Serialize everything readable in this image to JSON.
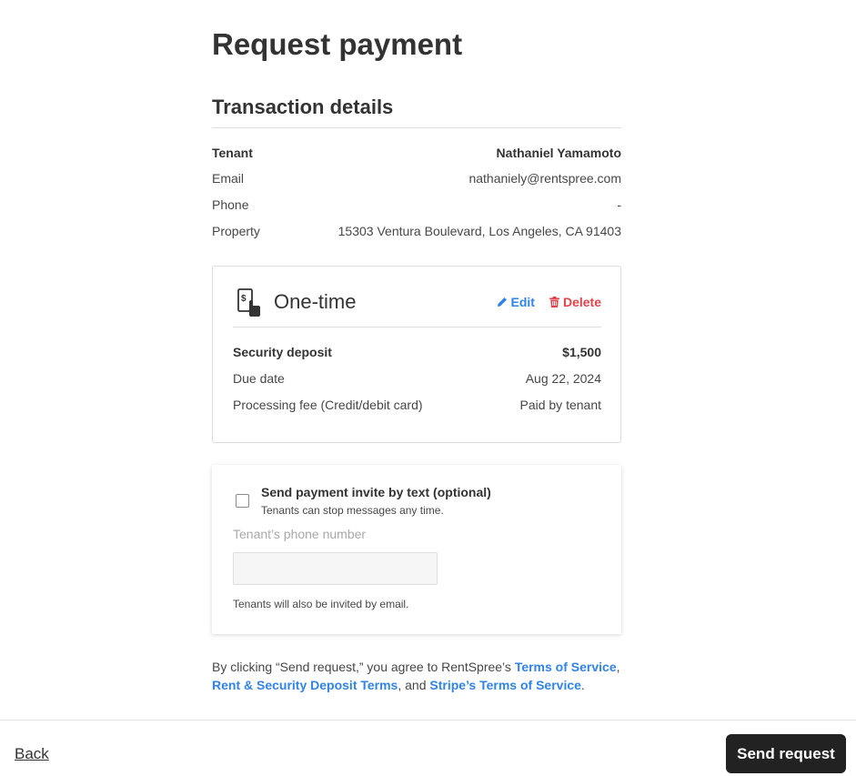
{
  "page": {
    "title": "Request payment"
  },
  "transaction": {
    "section_title": "Transaction details",
    "rows": [
      {
        "label": "Tenant",
        "value": "Nathaniel Yamamoto"
      },
      {
        "label": "Email",
        "value": "nathaniely@rentspree.com"
      },
      {
        "label": "Phone",
        "value": "-"
      },
      {
        "label": "Property",
        "value": "15303 Ventura Boulevard, Los Angeles, CA 91403"
      }
    ]
  },
  "payment_card": {
    "icon": "payment-hand-icon",
    "title": "One-time",
    "edit_label": "Edit",
    "delete_label": "Delete",
    "rows": [
      {
        "label": "Security deposit",
        "value": "$1,500"
      },
      {
        "label": "Due date",
        "value": "Aug 22, 2024"
      },
      {
        "label": "Processing fee (Credit/debit card)",
        "value": "Paid by tenant"
      }
    ]
  },
  "invite": {
    "checkbox_label": "Send payment invite by text (optional)",
    "checkbox_sub": "Tenants can stop messages any time.",
    "phone_label": "Tenant’s phone number",
    "phone_value": "",
    "note": "Tenants will also be invited by email."
  },
  "terms": {
    "prefix": "By clicking “Send request,” you agree to RentSpree’s ",
    "link1": "Terms of Service",
    "sep1": ",",
    "link2": "Rent & Security Deposit Terms",
    "sep2": ", and ",
    "link3": "Stripe’s Terms of Service",
    "suffix": "."
  },
  "footer": {
    "back_label": "Back",
    "send_label": "Send request"
  },
  "colors": {
    "link": "#3183e8",
    "delete": "#e2434b",
    "primary_button": "#222222"
  }
}
